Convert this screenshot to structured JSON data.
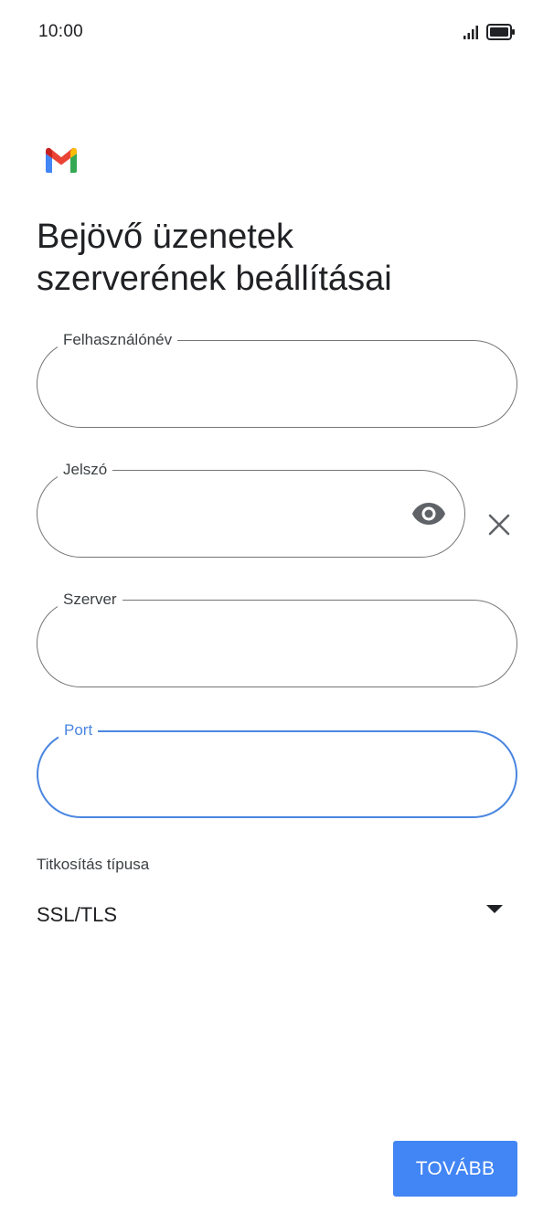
{
  "status_bar": {
    "time": "10:00",
    "signal_icon": "signal-icon",
    "battery_icon": "battery-icon"
  },
  "app": {
    "logo_icon": "gmail-logo-icon"
  },
  "page": {
    "title_line1": "Bejövő üzenetek",
    "title_line2": "szerverének beállításai"
  },
  "form": {
    "username": {
      "label": "Felhasználónév",
      "value": ""
    },
    "password": {
      "label": "Jelszó",
      "value": "",
      "toggle_icon": "eye-icon",
      "clear_icon": "close-icon"
    },
    "server": {
      "label": "Szerver",
      "value": ""
    },
    "port": {
      "label": "Port",
      "value": "",
      "focused": true
    },
    "encryption": {
      "label": "Titkosítás típusa",
      "selected": "SSL/TLS",
      "dropdown_icon": "dropdown-arrow-icon"
    }
  },
  "actions": {
    "next_label": "TOVÁBB"
  },
  "colors": {
    "accent": "#4285f4",
    "focus_border": "#4a86e0",
    "field_border": "#757575",
    "text": "#202124"
  }
}
